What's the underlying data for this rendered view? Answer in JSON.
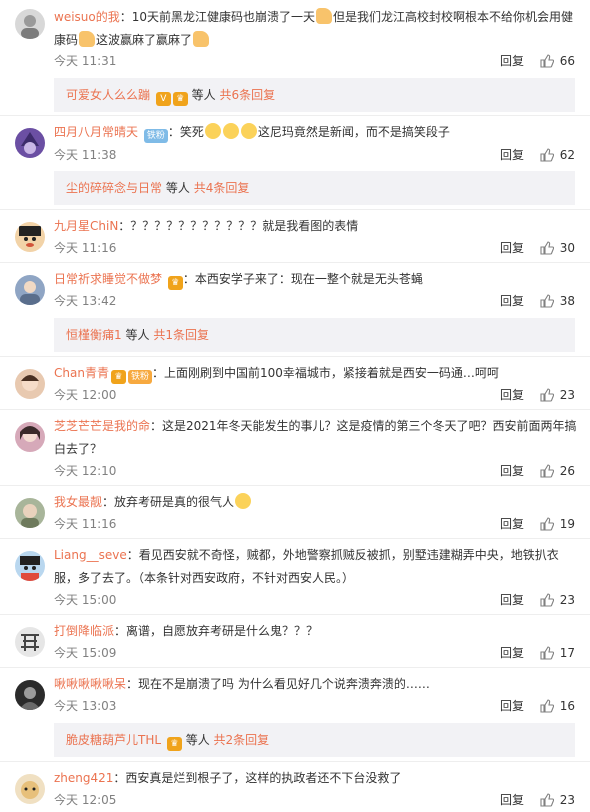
{
  "ui": {
    "reply_label": "回复",
    "others_label": "等人"
  },
  "comments": [
    {
      "user": "weisuo的我",
      "text_a": "：10天前黑龙江健康码也崩溃了一天",
      "text_b": "但是我们龙江高校封校啊根本不给你机会用健康码",
      "text_c": "这波赢麻了赢麻了",
      "time": "今天 11:31",
      "likes": "66",
      "sub": {
        "user": "可爱女人么么蹦",
        "more": "共6条回复"
      }
    },
    {
      "user": "四月八月常晴天",
      "tag": "铁粉",
      "text_a": "：笑死",
      "text_b": "这尼玛竟然是新闻，而不是搞笑段子",
      "time": "今天 11:38",
      "likes": "62",
      "sub": {
        "user": "尘的碎碎念与日常",
        "more": "共4条回复"
      }
    },
    {
      "user": "九月星ChiN",
      "text_a": "：？？？？？？？？？？？就是我看图的表情",
      "time": "今天 11:16",
      "likes": "30"
    },
    {
      "user": "日常祈求睡觉不做梦",
      "text_a": "：本西安学子来了：现在一整个就是无头苍蝇",
      "time": "今天 13:42",
      "likes": "38",
      "sub": {
        "user": "恒槿衡痡1",
        "more": "共1条回复"
      }
    },
    {
      "user": "Chan青青",
      "tag": "铁粉",
      "text_a": "：上面刚刷到中国前100幸福城市，紧接着就是西安一码通…呵呵",
      "time": "今天 12:00",
      "likes": "23"
    },
    {
      "user": "芝芝芒芒是我的命",
      "text_a": "：这是2021年冬天能发生的事儿？这是疫情的第三个冬天了吧？西安前面两年搞白去了？",
      "time": "今天 12:10",
      "likes": "26"
    },
    {
      "user": "我女最靓",
      "text_a": "：放弃考研是真的很气人",
      "time": "今天 11:16",
      "likes": "19"
    },
    {
      "user": "Liang__seve",
      "text_a": "：看见西安就不奇怪，贼都，外地警察抓贼反被抓，别墅违建糊弄中央，地铁扒衣服，多了去了。（本条针对西安政府，不针对西安人民。）",
      "time": "今天 15:00",
      "likes": "23"
    },
    {
      "user": "打倒降临派",
      "text_a": "：离谱，自愿放弃考研是什么鬼？？？",
      "time": "今天 15:09",
      "likes": "17"
    },
    {
      "user": "啾啾啾啾啾呆",
      "text_a": "：现在不是崩溃了吗 为什么看见好几个说奔溃奔溃的……",
      "time": "今天 13:03",
      "likes": "16",
      "sub": {
        "user": "脆皮糖葫芦儿THL",
        "more": "共2条回复"
      }
    },
    {
      "user": "zheng421",
      "text_a": "：西安真是烂到根子了，这样的执政者还不下台没救了",
      "time": "今天 12:05",
      "likes": "23"
    }
  ]
}
